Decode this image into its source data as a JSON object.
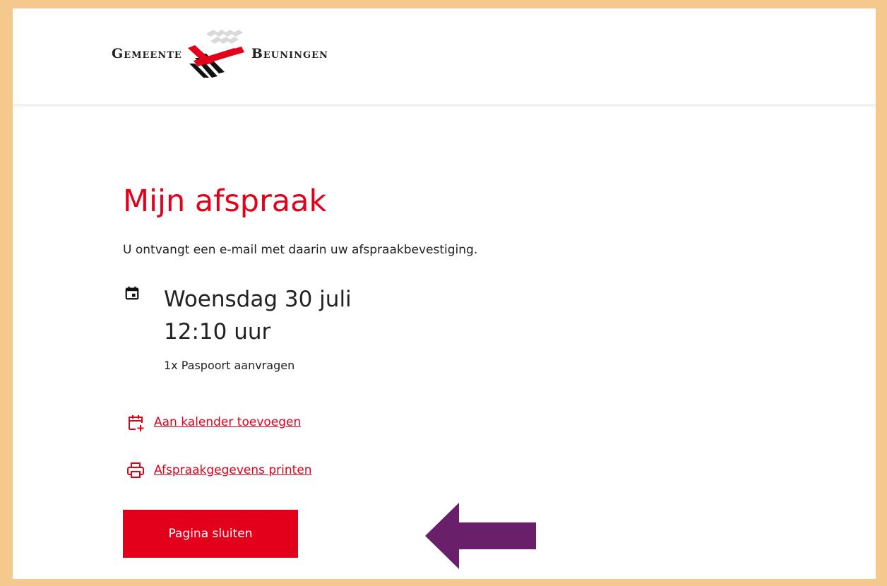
{
  "header": {
    "logo_left": "Gemeente",
    "logo_right": "Beuningen"
  },
  "main": {
    "title": "Mijn afspraak",
    "intro": "U ontvangt een e-mail met daarin uw afspraakbevestiging.",
    "appointment": {
      "date": "Woensdag 30 juli",
      "time": "12:10 uur",
      "product": "1x Paspoort aanvragen"
    },
    "links": {
      "calendar": "Aan kalender toevoegen",
      "print": "Afspraakgegevens printen"
    },
    "close_button": "Pagina sluiten"
  },
  "colors": {
    "accent": "#e3001b",
    "frame": "#f5c98e",
    "annotation_arrow": "#6a1f6a"
  },
  "icons": {
    "calendar": "calendar-icon",
    "add_calendar": "calendar-plus-icon",
    "print": "printer-icon"
  }
}
